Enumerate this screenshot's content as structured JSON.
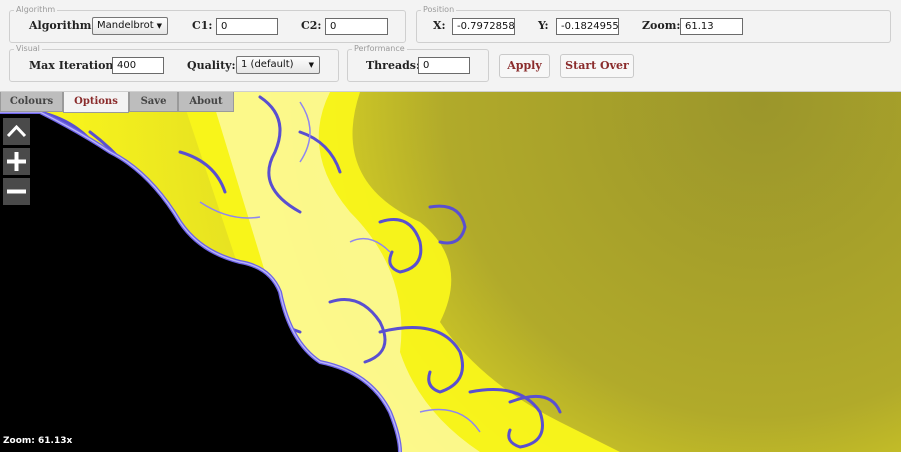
{
  "groups": {
    "algorithm": "Algorithm",
    "position": "Position",
    "visual": "Visual",
    "performance": "Performance"
  },
  "algorithm": {
    "label": "Algorithm:",
    "value": "Mandelbrot"
  },
  "c1": {
    "label": "C1:",
    "value": "0"
  },
  "c2": {
    "label": "C2:",
    "value": "0"
  },
  "x": {
    "label": "X:",
    "value": "-0.7972858"
  },
  "y": {
    "label": "Y:",
    "value": "-0.1824955"
  },
  "zoom": {
    "label": "Zoom:",
    "value": "61.13"
  },
  "max_iterations": {
    "label": "Max Iterations:",
    "value": "400"
  },
  "quality": {
    "label": "Quality:",
    "value": "1 (default)"
  },
  "threads": {
    "label": "Threads:",
    "value": "0"
  },
  "buttons": {
    "apply": "Apply",
    "start_over": "Start Over"
  },
  "tabs": [
    "Colours",
    "Options",
    "Save",
    "About"
  ],
  "active_tab": "Options",
  "nav": {
    "up": "chevron-up-icon",
    "zoom_in": "plus-icon",
    "zoom_out": "minus-icon"
  },
  "zoom_readout": "Zoom: 61.13x",
  "colors": {
    "fractal_yellow": "#f2ee1e",
    "fractal_dark_yellow": "#a09a2b",
    "fractal_violet": "#5a4fd0",
    "fractal_black": "#000000",
    "accent": "#8a2b2b"
  }
}
